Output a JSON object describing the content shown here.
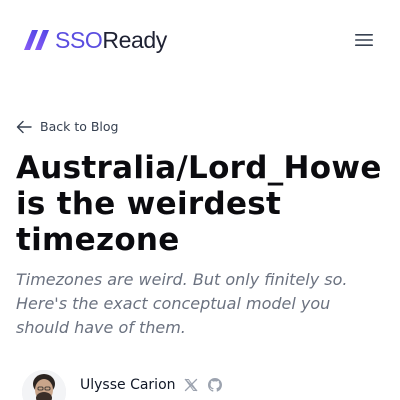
{
  "header": {
    "logo": {
      "text_prefix": "SSO",
      "text_suffix": "Ready",
      "icon": "slash-marks-logo"
    },
    "menu_icon": "hamburger-menu-icon"
  },
  "back_link": {
    "icon": "arrow-left-icon",
    "label": "Back to Blog"
  },
  "article": {
    "title": "Australia/Lord_Howe is the weirdest timezone",
    "subtitle": "Timezones are weird. But only finitely so. Here's the exact conceptual model you should have of them."
  },
  "author": {
    "name": "Ulysse Carion",
    "social_icons": [
      "x-icon",
      "github-icon"
    ]
  },
  "colors": {
    "brand_purple": "#5b4ee0",
    "text_dark": "#0b0b0f",
    "text_muted": "#6b7280",
    "icon_gray": "#9ca3af"
  }
}
